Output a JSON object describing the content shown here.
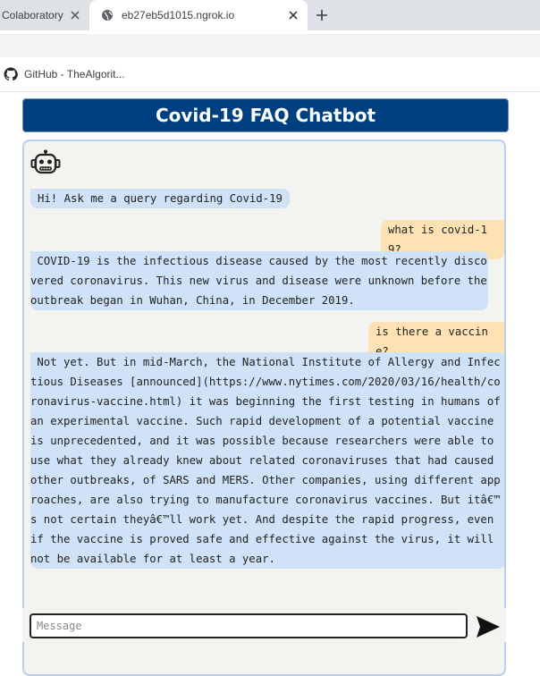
{
  "browser": {
    "tabs": [
      {
        "title": "Colaboratory",
        "active": false
      },
      {
        "title": "eb27eb5d1015.ngrok.io",
        "active": true
      }
    ],
    "bookmarks": [
      {
        "label": "GitHub - TheAlgorit..."
      }
    ]
  },
  "page": {
    "title": "Covid-19 FAQ Chatbot",
    "messages": [
      {
        "from": "bot",
        "text": "Hi! Ask me a query regarding Covid-19"
      },
      {
        "from": "user",
        "text": "what is covid-19?"
      },
      {
        "from": "bot",
        "text": " COVID-19 is the infectious disease caused by the most recently discovered coronavirus. This new virus and disease were unknown before the outbreak began in Wuhan, China, in December 2019."
      },
      {
        "from": "user",
        "text": "is there a vaccine?"
      },
      {
        "from": "bot",
        "text": " Not yet. But in mid-March, the National Institute of Allergy and Infectious Diseases [announced](https://www.nytimes.com/2020/03/16/health/coronavirus-vaccine.html) it was beginning the first testing in humans of an experimental vaccine. Such rapid development of a potential vaccine is unprecedented, and it was possible because researchers were able to use what they already knew about related coronaviruses that had caused other outbreaks, of SARS and MERS. Other companies, using different approaches, are also trying to manufacture coronavirus vaccines. But itâ€™s not certain theyâ€™ll work yet. And despite the rapid progress, even if the vaccine is proved safe and effective against the virus, it will not be available for at least a year."
      }
    ],
    "input": {
      "value": "",
      "placeholder": "Message"
    }
  },
  "colors": {
    "header": "#003f80",
    "bot_bubble": "#cfe2f8",
    "user_bubble": "#fde3b3",
    "panel": "#f3f3ef"
  }
}
